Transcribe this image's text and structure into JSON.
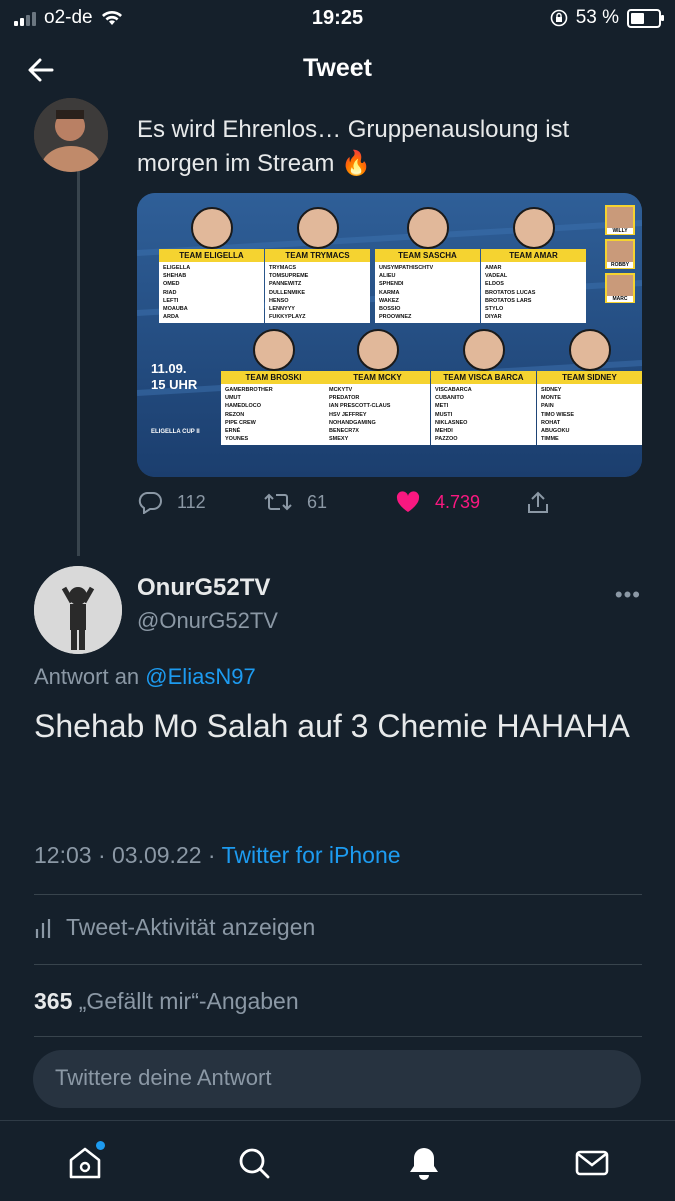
{
  "status_bar": {
    "carrier": "o2-de",
    "time": "19:25",
    "battery": "53 %",
    "battery_level": 0.53
  },
  "header": {
    "title": "Tweet"
  },
  "parent_tweet": {
    "text": "Es wird Ehrenlos… Gruppenausloung ist morgen im Stream",
    "emoji": "🔥",
    "actions": {
      "replies": "112",
      "retweets": "61",
      "likes": "4.739"
    },
    "poster": {
      "date": "11.09.",
      "time": "15 UHR",
      "cup": "ELIGELLA CUP II",
      "side_names": [
        "WILLY",
        "ROBBY",
        "MARC"
      ],
      "teams": [
        {
          "name": "TEAM ELIGELLA",
          "players": [
            "ELIGELLA",
            "SHEHAB",
            "OMED",
            "RIAD",
            "LEFTI",
            "MOAUBA",
            "ARDA"
          ]
        },
        {
          "name": "TEAM TRYMACS",
          "players": [
            "TRYMACS",
            "TOMSUPREME",
            "PANNEWITZ",
            "DULLENMIKE",
            "HENSO",
            "LENNYYY",
            "FUKKYPLAYZ"
          ]
        },
        {
          "name": "TEAM SASCHA",
          "players": [
            "UNSYMPATHISCHTV",
            "ALIEU",
            "SPHENDI",
            "KARMA",
            "WAKEZ",
            "BOSSIO",
            "PROOWNEZ"
          ]
        },
        {
          "name": "TEAM AMAR",
          "players": [
            "AMAR",
            "VADEAL",
            "ELDOS",
            "BROTATOS LUCAS",
            "BROTATOS LARS",
            "STYLO",
            "DIYAR"
          ]
        },
        {
          "name": "TEAM BROSKI",
          "players": [
            "GAMERBROTHER",
            "UMUT",
            "HAMEDLOCO",
            "REZON",
            "PIPE CREW",
            "ERNÉ",
            "YOUNES"
          ]
        },
        {
          "name": "TEAM MCKY",
          "players": [
            "MCKYTV",
            "PREDATOR",
            "IAN PRESCOTT-CLAUS",
            "HSV JEFFREY",
            "NOHANDGAMING",
            "BENECR7X",
            "SMEXY"
          ]
        },
        {
          "name": "TEAM VISCA BARCA",
          "players": [
            "VISCABARCA",
            "CUBANITO",
            "METI",
            "MUSTI",
            "NIKLASNEO",
            "MEHDI",
            "PAZZOO"
          ]
        },
        {
          "name": "TEAM SIDNEY",
          "players": [
            "SIDNEY",
            "MONTE",
            "PAIN",
            "TIMO WIESE",
            "ROHAT",
            "ABUGOKU",
            "TIMME"
          ]
        }
      ]
    }
  },
  "reply": {
    "display_name": "OnurG52TV",
    "handle": "@OnurG52TV",
    "reply_to_label": "Antwort an",
    "reply_to_handle": "@EliasN97",
    "text": "Shehab Mo Salah auf 3 Chemie HAHAHA",
    "timestamp": "12:03 · 03.09.22 · ",
    "source": "Twitter for iPhone",
    "activity_label": "Tweet-Aktivität anzeigen",
    "like_count": "365",
    "like_label": " „Gefällt mir“-Angaben"
  },
  "compose": {
    "placeholder": "Twittere deine Antwort"
  },
  "colors": {
    "background": "#15202b",
    "accent": "#1d9bf0",
    "like": "#f91880",
    "muted": "#8b98a5"
  }
}
